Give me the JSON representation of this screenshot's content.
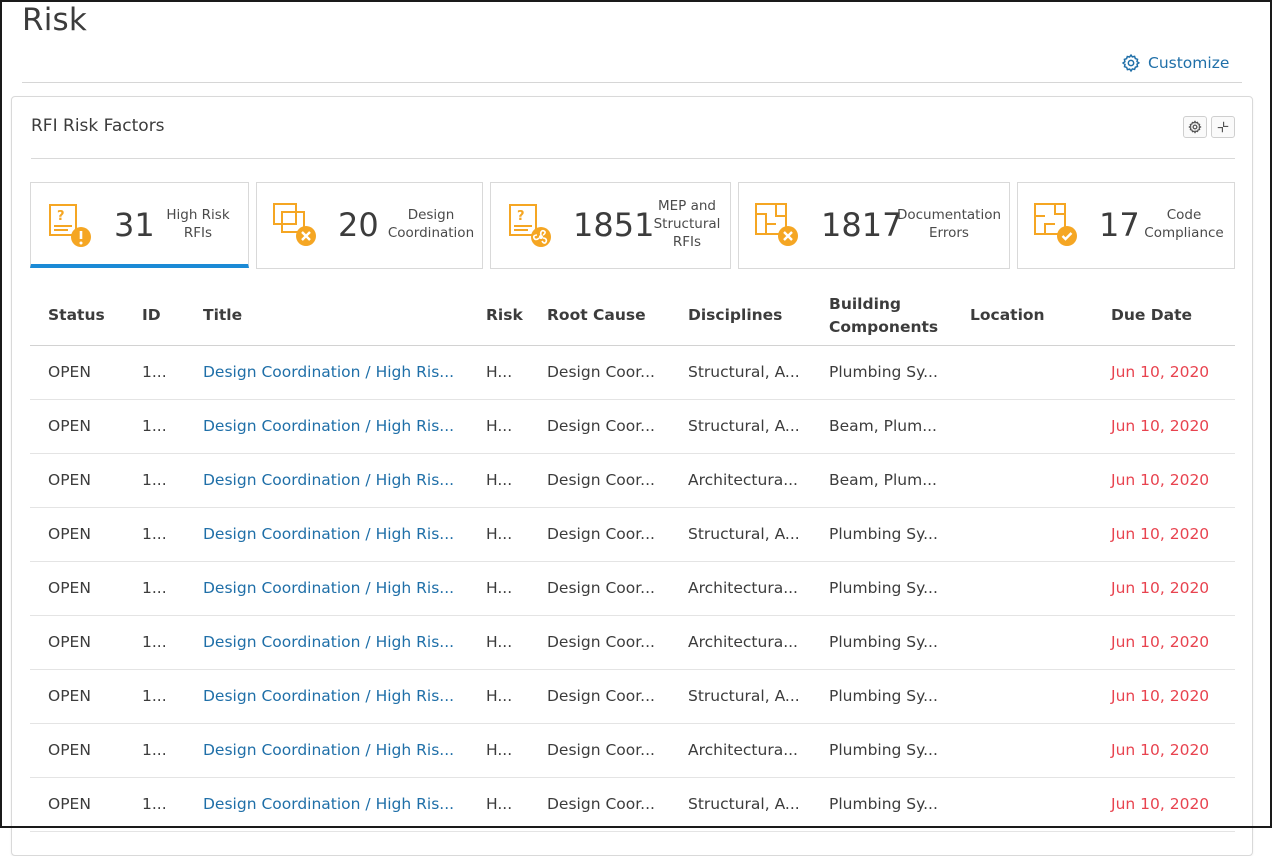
{
  "page": {
    "title": "Risk",
    "customize_label": "Customize"
  },
  "card": {
    "title": "RFI Risk Factors"
  },
  "tiles": [
    {
      "count": "31",
      "label_line1": "High Risk",
      "label_line2": "RFIs",
      "label_line3": "",
      "icon": "rfi-warning-icon"
    },
    {
      "count": "20",
      "label_line1": "Design",
      "label_line2": "Coordination",
      "label_line3": "",
      "icon": "design-coordination-icon"
    },
    {
      "count": "1851",
      "label_line1": "MEP and",
      "label_line2": "Structural",
      "label_line3": "RFIs",
      "icon": "rfi-mep-icon"
    },
    {
      "count": "1817",
      "label_line1": "Documentation",
      "label_line2": "Errors",
      "label_line3": "",
      "icon": "documentation-error-icon"
    },
    {
      "count": "17",
      "label_line1": "Code",
      "label_line2": "Compliance",
      "label_line3": "",
      "icon": "code-compliance-icon"
    }
  ],
  "accent_color": "#1b8ad6",
  "icon_color": "#f5a623",
  "due_color": "#e8434f",
  "table": {
    "headers": {
      "status": "Status",
      "id": "ID",
      "title": "Title",
      "risk": "Risk",
      "root_cause": "Root Cause",
      "disciplines": "Disciplines",
      "building_line1": "Building",
      "building_line2": "Components",
      "location": "Location",
      "due_date": "Due Date"
    },
    "rows": [
      {
        "status": "OPEN",
        "id": "1...",
        "title": "Design Coordination / High Ris...",
        "risk": "H...",
        "root_cause": "Design Coor...",
        "disciplines": "Structural, A...",
        "components": "Plumbing Sy...",
        "location": "",
        "due": "Jun 10, 2020"
      },
      {
        "status": "OPEN",
        "id": "1...",
        "title": "Design Coordination / High Ris...",
        "risk": "H...",
        "root_cause": "Design Coor...",
        "disciplines": "Structural, A...",
        "components": "Beam, Plum...",
        "location": "",
        "due": "Jun 10, 2020"
      },
      {
        "status": "OPEN",
        "id": "1...",
        "title": "Design Coordination / High Ris...",
        "risk": "H...",
        "root_cause": "Design Coor...",
        "disciplines": "Architectura...",
        "components": "Beam, Plum...",
        "location": "",
        "due": "Jun 10, 2020"
      },
      {
        "status": "OPEN",
        "id": "1...",
        "title": "Design Coordination / High Ris...",
        "risk": "H...",
        "root_cause": "Design Coor...",
        "disciplines": "Structural, A...",
        "components": "Plumbing Sy...",
        "location": "",
        "due": "Jun 10, 2020"
      },
      {
        "status": "OPEN",
        "id": "1...",
        "title": "Design Coordination / High Ris...",
        "risk": "H...",
        "root_cause": "Design Coor...",
        "disciplines": "Architectura...",
        "components": "Plumbing Sy...",
        "location": "",
        "due": "Jun 10, 2020"
      },
      {
        "status": "OPEN",
        "id": "1...",
        "title": "Design Coordination / High Ris...",
        "risk": "H...",
        "root_cause": "Design Coor...",
        "disciplines": "Architectura...",
        "components": "Plumbing Sy...",
        "location": "",
        "due": "Jun 10, 2020"
      },
      {
        "status": "OPEN",
        "id": "1...",
        "title": "Design Coordination / High Ris...",
        "risk": "H...",
        "root_cause": "Design Coor...",
        "disciplines": "Structural, A...",
        "components": "Plumbing Sy...",
        "location": "",
        "due": "Jun 10, 2020"
      },
      {
        "status": "OPEN",
        "id": "1...",
        "title": "Design Coordination / High Ris...",
        "risk": "H...",
        "root_cause": "Design Coor...",
        "disciplines": "Architectura...",
        "components": "Plumbing Sy...",
        "location": "",
        "due": "Jun 10, 2020"
      },
      {
        "status": "OPEN",
        "id": "1...",
        "title": "Design Coordination / High Ris...",
        "risk": "H...",
        "root_cause": "Design Coor...",
        "disciplines": "Structural, A...",
        "components": "Plumbing Sy...",
        "location": "",
        "due": "Jun 10, 2020"
      }
    ]
  }
}
